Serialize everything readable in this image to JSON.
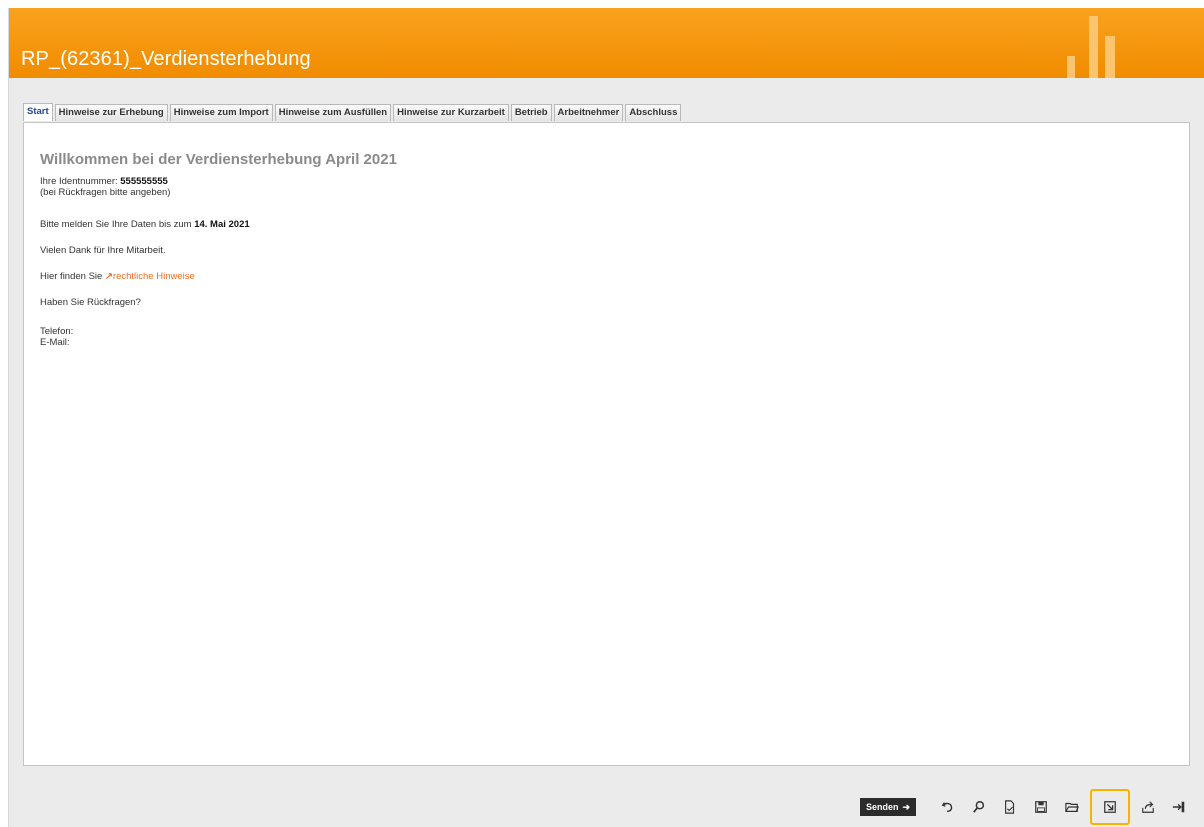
{
  "header": {
    "title": "RP_(62361)_Verdiensterhebung"
  },
  "tabs": [
    {
      "label": "Start"
    },
    {
      "label": "Hinweise zur Erhebung"
    },
    {
      "label": "Hinweise zum Import"
    },
    {
      "label": "Hinweise zum Ausfüllen"
    },
    {
      "label": "Hinweise zur Kurzarbeit"
    },
    {
      "label": "Betrieb"
    },
    {
      "label": "Arbeitnehmer"
    },
    {
      "label": "Abschluss"
    }
  ],
  "content": {
    "welcome": "Willkommen bei der Verdiensterhebung April 2021",
    "ident_label": "Ihre Identnummer:",
    "ident_value": "555555555",
    "ident_note": "(bei Rückfragen bitte angeben)",
    "deadline_text": "Bitte melden Sie Ihre Daten bis zum",
    "deadline_date": "14. Mai 2021",
    "thanks": "Vielen Dank für Ihre Mitarbeit.",
    "legal_prefix": "Hier finden Sie",
    "legal_link": "rechtliche Hinweise",
    "questions": "Haben Sie Rückfragen?",
    "phone_label": "Telefon:",
    "email_label": "E-Mail:"
  },
  "toolbar": {
    "send_label": "Senden",
    "highlight_color": "#f5b400",
    "icons": [
      "undo-icon",
      "search-icon",
      "check-document-icon",
      "save-icon",
      "open-folder-icon",
      "import-icon",
      "export-icon",
      "exit-icon"
    ]
  },
  "colors": {
    "header": "#f39200",
    "link": "#e8711f",
    "tab_active": "#20459a"
  }
}
